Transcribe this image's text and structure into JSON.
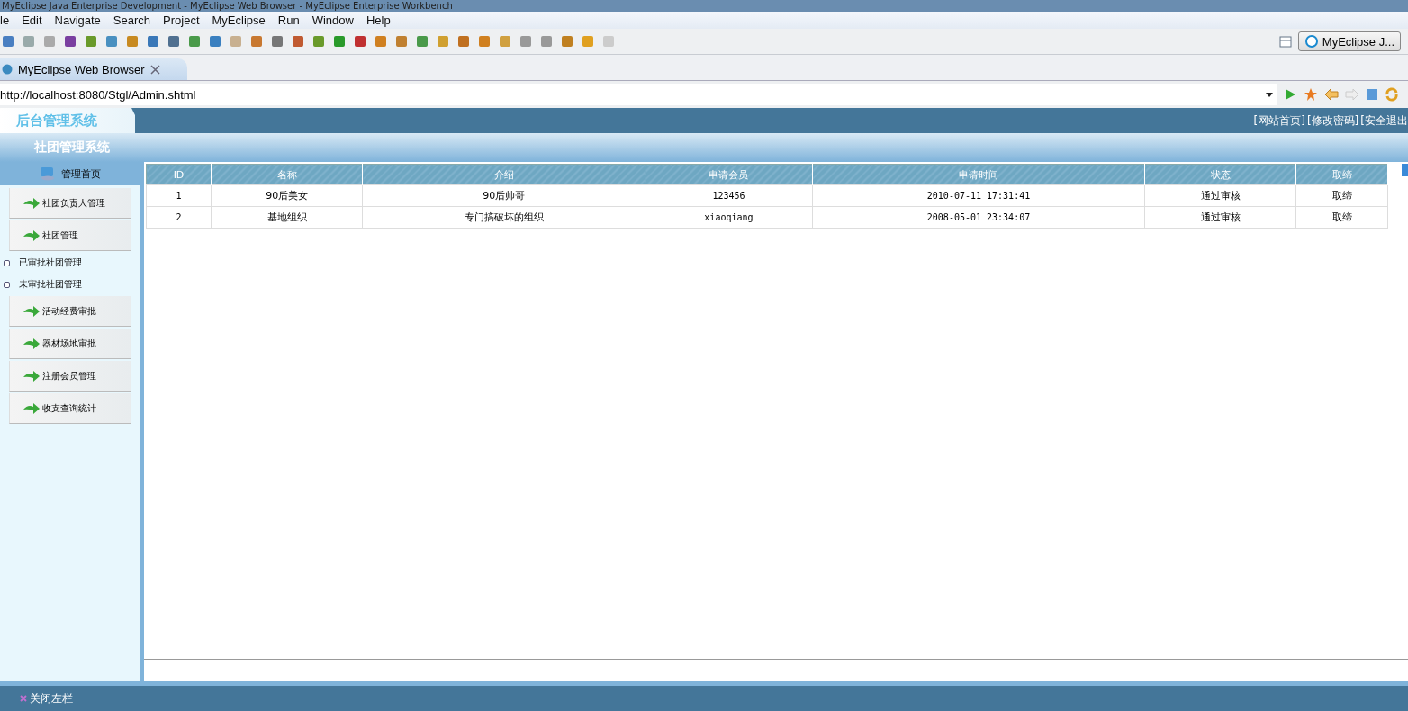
{
  "window": {
    "title": "MyEclipse Java Enterprise Development - MyEclipse Web Browser - MyEclipse Enterprise Workbench"
  },
  "menu": [
    "le",
    "Edit",
    "Navigate",
    "Search",
    "Project",
    "MyEclipse",
    "Run",
    "Window",
    "Help"
  ],
  "perspective": {
    "label": "MyEclipse J..."
  },
  "editor_tab": {
    "label": "MyEclipse Web Browser",
    "selected": true
  },
  "address": {
    "value": "http://localhost:8080/Stgl/Admin.shtml"
  },
  "page": {
    "logo": "后台管理系统",
    "top_links": [
      "[网站首页]",
      "[修改密码]",
      "[安全退出"
    ],
    "subtitle": "社团管理系统",
    "sidebar": {
      "home": "管理首页",
      "items": [
        {
          "kind": "button",
          "label": "社团负责人管理"
        },
        {
          "kind": "button",
          "label": "社团管理"
        },
        {
          "kind": "subitem",
          "label": "已审批社团管理"
        },
        {
          "kind": "subitem",
          "label": "未审批社团管理"
        },
        {
          "kind": "button",
          "label": "活动经费审批"
        },
        {
          "kind": "button",
          "label": "器材场地审批"
        },
        {
          "kind": "button",
          "label": "注册会员管理"
        },
        {
          "kind": "button",
          "label": "收支查询统计"
        }
      ]
    },
    "table": {
      "columns": [
        "ID",
        "名称",
        "介绍",
        "申请会员",
        "申请时间",
        "状态",
        "取缔"
      ],
      "rows": [
        [
          "1",
          "90后美女",
          "90后帅哥",
          "123456",
          "2010-07-11 17:31:41",
          "通过审核",
          "取缔"
        ],
        [
          "2",
          "基地组织",
          "专门搞破坏的组织",
          "xiaoqiang",
          "2008-05-01 23:34:07",
          "通过审核",
          "取缔"
        ]
      ]
    },
    "footer": {
      "label": "关闭左栏"
    }
  }
}
